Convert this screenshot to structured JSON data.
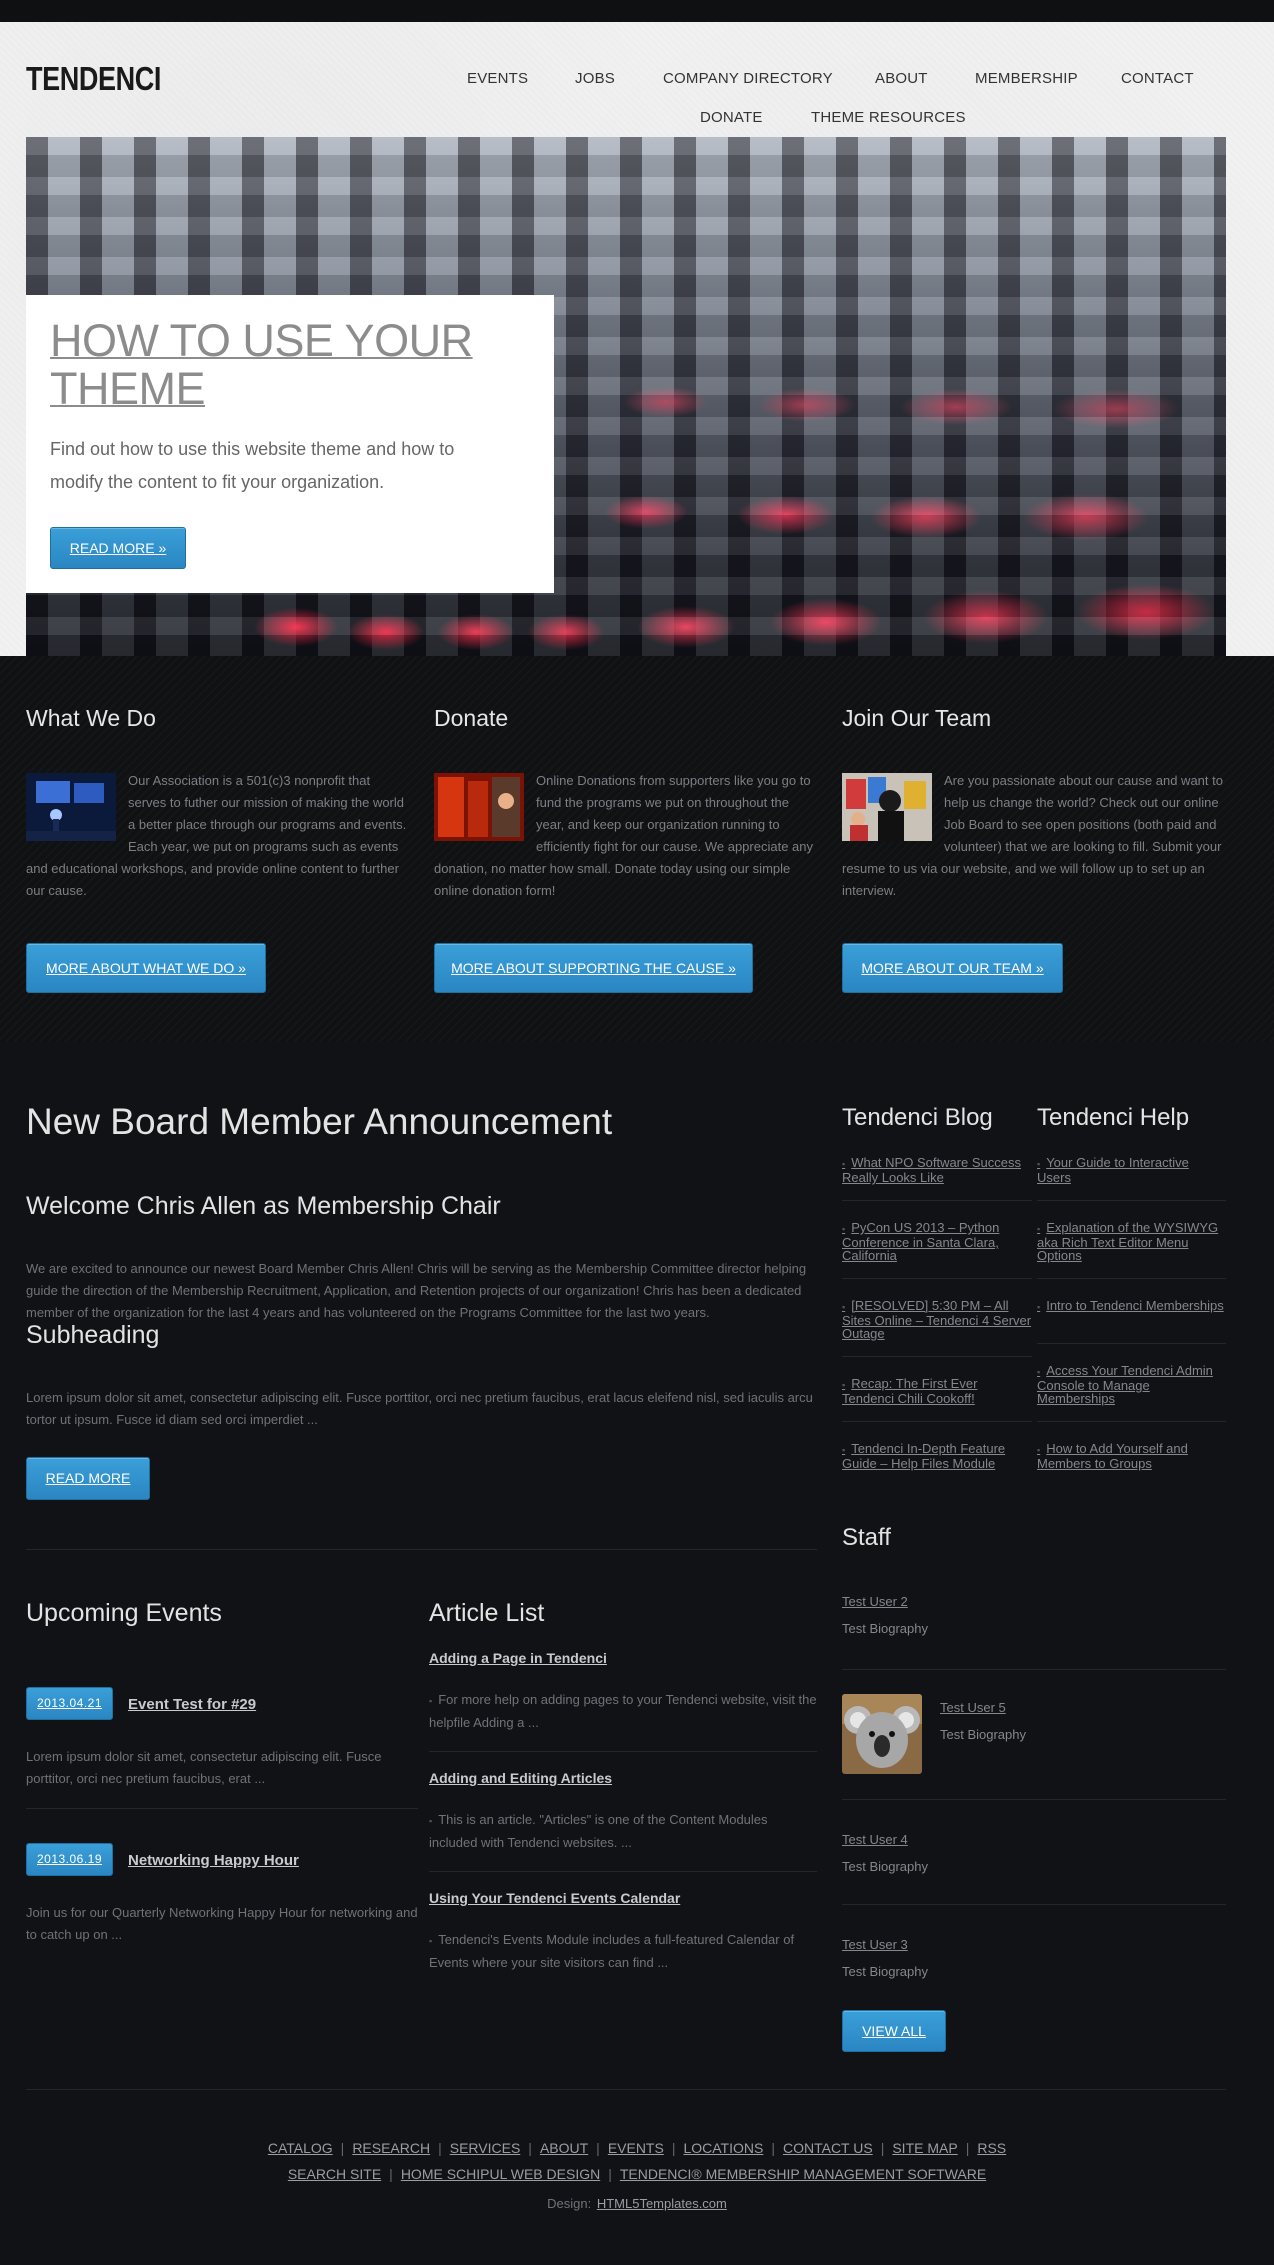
{
  "site": {
    "logo": "TENDENCI"
  },
  "nav": {
    "items": [
      "EVENTS",
      "JOBS",
      "COMPANY DIRECTORY",
      "ABOUT",
      "MEMBERSHIP",
      "CONTACT",
      "DONATE",
      "THEME RESOURCES"
    ]
  },
  "hero": {
    "title": "HOW TO USE YOUR THEME",
    "text": "Find out how to use this website theme and how to modify the content to fit your organization.",
    "button": "READ MORE »"
  },
  "features": [
    {
      "title": "What We Do",
      "text": "Our Association is a 501(c)3 nonprofit that serves to futher our mission of making the world a better place through our programs and events. Each year, we put on programs such as events and educational workshops, and provide online content to further our cause.",
      "button": "MORE ABOUT WHAT WE DO »"
    },
    {
      "title": "Donate",
      "text": "Online Donations from supporters like you go to fund the programs we put on throughout the year, and keep our organization running to efficiently fight for our cause. We appreciate any donation, no matter how small. Donate today using our simple online donation form!",
      "button": "MORE ABOUT SUPPORTING THE CAUSE »"
    },
    {
      "title": "Join Our Team",
      "text": "Are you passionate about our cause and want to help us change the world? Check out our online Job Board to see open positions (both paid and volunteer) that we are looking to fill. Submit your resume to us via our website, and we will follow up to set up an interview.",
      "button": "MORE ABOUT OUR TEAM »"
    }
  ],
  "article": {
    "title": "New Board Member Announcement",
    "subtitle": "Welcome Chris Allen as Membership Chair",
    "body": "We are excited to announce our newest Board Member Chris Allen! Chris will be serving as the Membership Committee director helping guide the direction of the Membership Recruitment, Application, and Retention projects of our organization! Chris has been a dedicated member of the organization for the last 4 years and has volunteered on the Programs Committee for the last two years.",
    "subheading": "Subheading",
    "lorem": "Lorem ipsum dolor sit amet, consectetur adipiscing elit. Fusce porttitor, orci nec pretium faucibus, erat lacus eleifend nisl, sed iaculis arcu tortor ut ipsum. Fusce id diam sed orci imperdiet ...",
    "button": "READ MORE"
  },
  "blog": {
    "title": "Tendenci Blog",
    "items": [
      "What NPO Software Success Really Looks Like",
      "PyCon US 2013 – Python Conference in Santa Clara, California",
      "[RESOLVED] 5:30 PM – All Sites Online – Tendenci 4 Server Outage",
      "Recap: The First Ever Tendenci Chili Cookoff!",
      "Tendenci In-Depth Feature Guide – Help Files Module"
    ]
  },
  "help": {
    "title": "Tendenci Help",
    "items": [
      "Your Guide to Interactive Users",
      "Explanation of the WYSIWYG aka Rich Text Editor Menu Options",
      "Intro to Tendenci Memberships",
      "Access Your Tendenci Admin Console to Manage Memberships",
      "How to Add Yourself and Members to Groups"
    ]
  },
  "events": {
    "title": "Upcoming Events",
    "items": [
      {
        "date": "2013.04.21",
        "title": "Event Test for #29",
        "text": "Lorem ipsum dolor sit amet, consectetur adipiscing elit. Fusce porttitor, orci nec pretium faucibus, erat ..."
      },
      {
        "date": "2013.06.19",
        "title": "Networking Happy Hour",
        "text": "Join us for our Quarterly Networking Happy Hour for networking and to catch up on ..."
      }
    ]
  },
  "articles": {
    "title": "Article List",
    "items": [
      {
        "title": "Adding a Page in Tendenci",
        "text": "For more help on adding pages to your Tendenci website, visit the helpfile Adding a ..."
      },
      {
        "title": "Adding and Editing Articles",
        "text": "This is an article. \"Articles\" is one of the Content Modules included with Tendenci websites. ..."
      },
      {
        "title": "Using Your Tendenci Events Calendar",
        "text": "Tendenci's Events Module includes a full-featured Calendar of Events where your site visitors can find ..."
      }
    ]
  },
  "staff": {
    "title": "Staff",
    "members": [
      {
        "name": "Test User 2",
        "bio": "Test Biography"
      },
      {
        "name": "Test User 5",
        "bio": "Test Biography"
      },
      {
        "name": "Test User 4",
        "bio": "Test Biography"
      },
      {
        "name": "Test User 3",
        "bio": "Test Biography"
      }
    ],
    "button": "VIEW ALL"
  },
  "footer": {
    "row1": [
      "CATALOG",
      "RESEARCH",
      "SERVICES",
      "ABOUT",
      "EVENTS",
      "LOCATIONS",
      "CONTACT US",
      "SITE MAP",
      "RSS"
    ],
    "row2": [
      "SEARCH SITE",
      "HOME SCHIPUL WEB DESIGN",
      "TENDENCI® MEMBERSHIP MANAGEMENT SOFTWARE"
    ],
    "design_label": "Design:",
    "design_link": "HTML5Templates.com"
  },
  "colors": {
    "accent": "#2a86c2",
    "background": "#111215",
    "header_bg": "#f1f1f1"
  }
}
